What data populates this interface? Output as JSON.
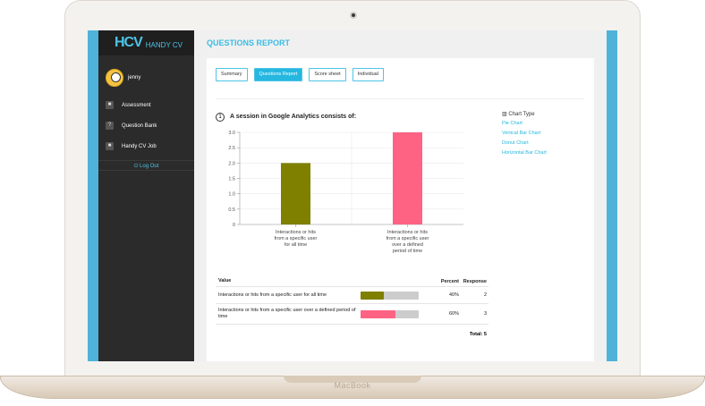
{
  "device": {
    "brand": "MacBook"
  },
  "app": {
    "logo_mark": "HCV",
    "logo_text": "HANDY CV",
    "page_title": "QUESTIONS REPORT"
  },
  "user": {
    "name": "jenny"
  },
  "sidebar": {
    "items": [
      {
        "label": "Assessment",
        "icon": "briefcase-icon"
      },
      {
        "label": "Question Bank",
        "icon": "question-icon"
      },
      {
        "label": "Handy CV Job",
        "icon": "suitcase-icon"
      }
    ],
    "logout": "Log Out"
  },
  "tabs": [
    {
      "label": "Summary",
      "active": false
    },
    {
      "label": "Questions Report",
      "active": true
    },
    {
      "label": "Score sheet",
      "active": false
    },
    {
      "label": "Individual",
      "active": false
    }
  ],
  "question": {
    "number": "1",
    "text": "A session in Google Analytics consists of:"
  },
  "chart_type": {
    "title": "Chart Type",
    "options": [
      "Pie Chart",
      "Vertical Bar Chart",
      "Donut Chart",
      "Horizontal Bar Chart"
    ]
  },
  "chart_data": {
    "type": "bar",
    "categories": [
      [
        "Interactions or hits",
        "from a specific user",
        "for all time"
      ],
      [
        "Interactions or hits",
        "from a specific user",
        "over a defined",
        "period of time"
      ]
    ],
    "values": [
      2,
      3
    ],
    "colors": [
      "#7f7f00",
      "#ff6384"
    ],
    "ylim": [
      0,
      3
    ],
    "yticks": [
      "0",
      "0.5",
      "1.0",
      "1.5",
      "2.0",
      "2.5",
      "3.0"
    ],
    "grid": true
  },
  "table": {
    "headers": {
      "value": "Value",
      "percent": "Percent",
      "response": "Response"
    },
    "rows": [
      {
        "value": "Interactions or hits from a specific user for all time",
        "percent_label": "40%",
        "fraction": 0.4,
        "response": "2",
        "color": "#7f7f00"
      },
      {
        "value": "Interactions or hits from a specific user over a defined period of time",
        "percent_label": "60%",
        "fraction": 0.6,
        "response": "3",
        "color": "#ff6384"
      }
    ],
    "total": "Total: 5"
  }
}
